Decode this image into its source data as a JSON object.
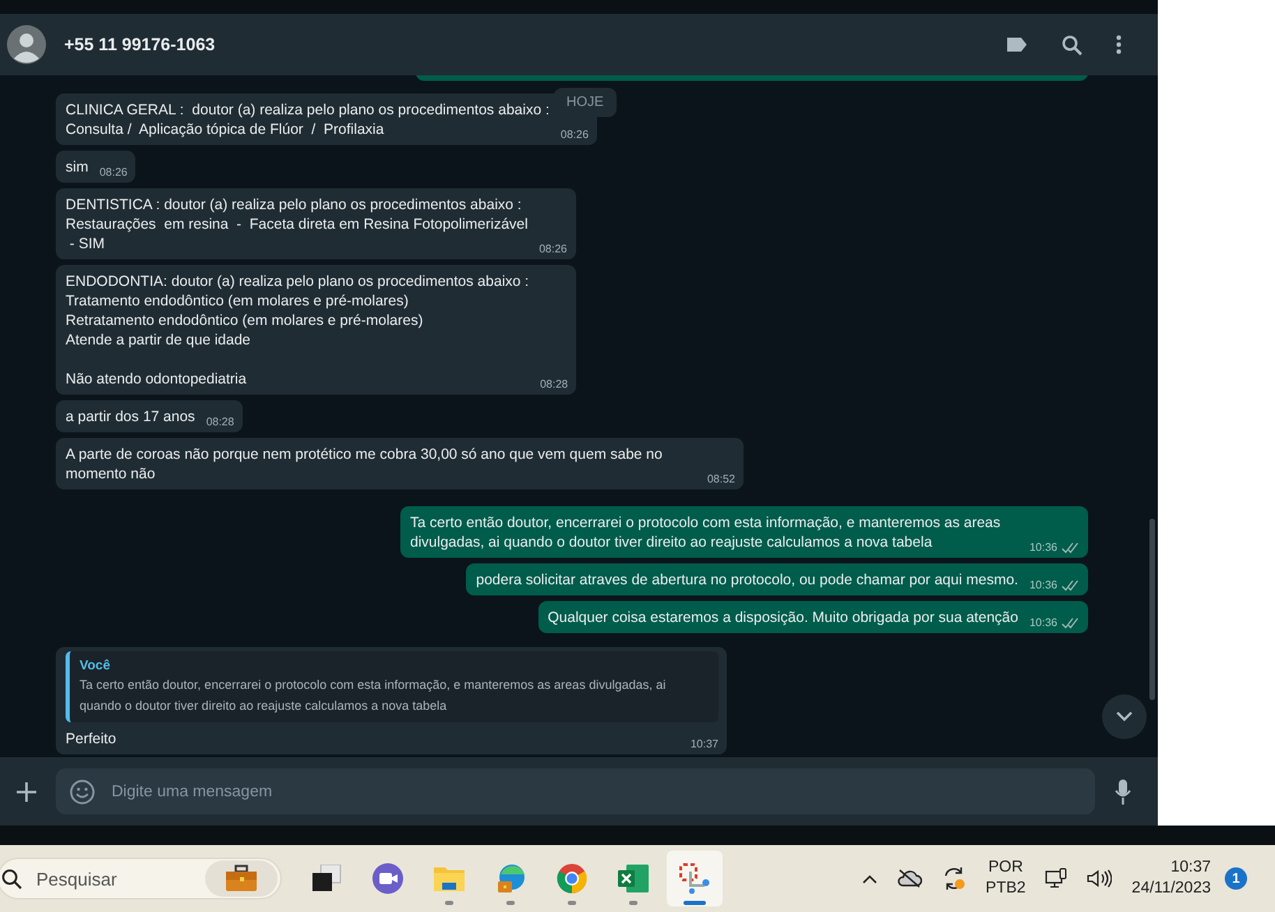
{
  "header": {
    "contact": "+55 11 99176-1063"
  },
  "date_chip": "HOJE",
  "messages": [
    {
      "kind": "incoming",
      "text": "CLINICA GERAL :  doutor (a) realiza pelo plano os procedimentos abaixo :\nConsulta /  Aplicação tópica de Flúor  /  Profilaxia",
      "time": "08:26"
    },
    {
      "kind": "incoming",
      "text": "sim",
      "time": "08:26"
    },
    {
      "kind": "incoming",
      "text": "DENTISTICA : doutor (a) realiza pelo plano os procedimentos abaixo :\nRestaurações  em resina  -  Faceta direta em Resina Fotopolimerizável\n - SIM",
      "time": "08:26"
    },
    {
      "kind": "incoming",
      "text": "ENDODONTIA: doutor (a) realiza pelo plano os procedimentos abaixo :\nTratamento endodôntico (em molares e pré-molares)\nRetratamento endodôntico (em molares e pré-molares)\nAtende a partir de que idade\n\nNão atendo odontopediatria",
      "time": "08:28"
    },
    {
      "kind": "incoming",
      "text": "a partir dos 17 anos",
      "time": "08:28"
    },
    {
      "kind": "incoming",
      "text": "A parte de coroas não porque nem protético me cobra 30,00 só ano que vem quem sabe no momento não",
      "time": "08:52"
    },
    {
      "kind": "outgoing",
      "text": "Ta certo então doutor, encerrarei o protocolo com esta informação, e manteremos as areas divulgadas, ai quando o doutor tiver direito ao reajuste calculamos a nova tabela",
      "time": "10:36"
    },
    {
      "kind": "outgoing",
      "text": "podera solicitar atraves de abertura no protocolo, ou pode chamar por aqui mesmo.",
      "time": "10:36"
    },
    {
      "kind": "outgoing",
      "text": "Qualquer coisa estaremos a disposição. Muito obrigada por sua atenção",
      "time": "10:36"
    },
    {
      "kind": "reply",
      "quote_author": "Você",
      "quote_text": "Ta certo então doutor, encerrarei o protocolo com esta informação, e manteremos as areas divulgadas, ai quando o doutor tiver direito ao reajuste calculamos a nova tabela",
      "text": "Perfeito",
      "time": "10:37"
    }
  ],
  "composer": {
    "placeholder": "Digite uma mensagem"
  },
  "taskbar": {
    "search_placeholder": "Pesquisar",
    "apps": [
      {
        "kind": "task-view",
        "running": false,
        "selected": false
      },
      {
        "kind": "meet",
        "running": false,
        "selected": false
      },
      {
        "kind": "files",
        "running": true,
        "selected": false
      },
      {
        "kind": "edge",
        "running": true,
        "selected": false
      },
      {
        "kind": "chrome",
        "running": true,
        "selected": false
      },
      {
        "kind": "excel",
        "running": true,
        "selected": false
      },
      {
        "kind": "snipping",
        "running": true,
        "selected": true
      }
    ],
    "language": "POR",
    "layout": "PTB2",
    "time": "10:37",
    "date": "24/11/2023",
    "notifications": "1"
  }
}
